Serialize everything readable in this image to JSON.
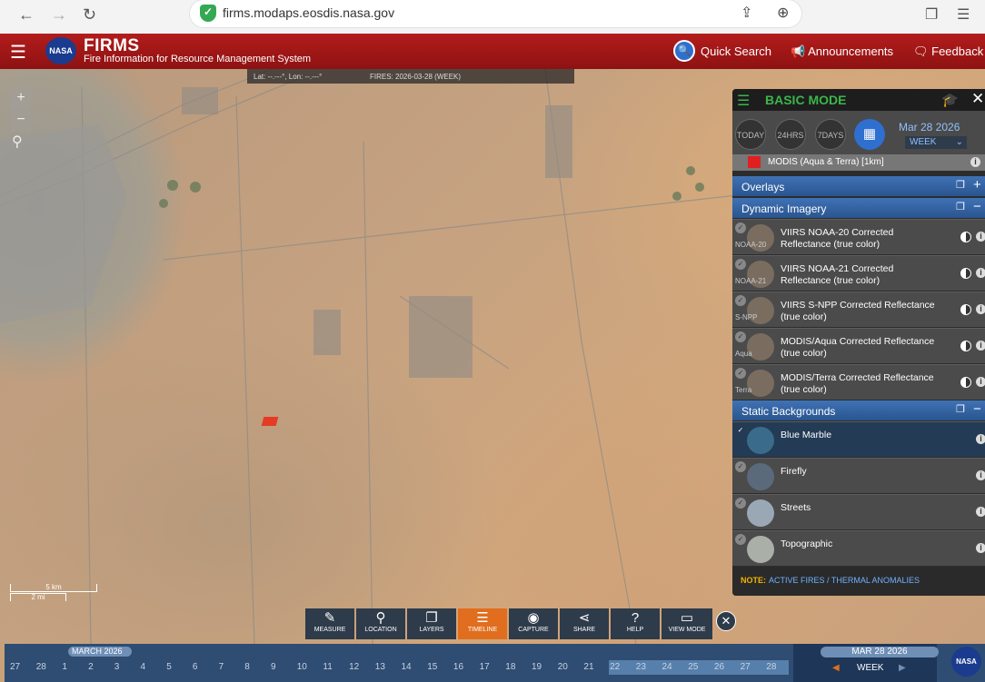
{
  "browser": {
    "url": "firms.modaps.eosdis.nasa.gov"
  },
  "header": {
    "logo_text": "NASA",
    "app_name": "FIRMS",
    "app_subtitle": "Fire Information for Resource Management System",
    "quick_search": "Quick Search",
    "announcements": "Announcements",
    "feedback": "Feedback"
  },
  "map": {
    "coords": "Lat: --.---°, Lon: --.---°",
    "fires_label": "FIRES: 2026-03-28 (WEEK)",
    "scale_km": "5 km",
    "scale_mi": "2 mi"
  },
  "toolbar": [
    {
      "icon": "✎",
      "label": "MEASURE",
      "name": "measure"
    },
    {
      "icon": "⚲",
      "label": "LOCATION",
      "name": "location"
    },
    {
      "icon": "❐",
      "label": "LAYERS",
      "name": "layers"
    },
    {
      "icon": "☰",
      "label": "TIMELINE",
      "name": "timeline",
      "active": true
    },
    {
      "icon": "◉",
      "label": "CAPTURE",
      "name": "capture"
    },
    {
      "icon": "⋖",
      "label": "SHARE",
      "name": "share"
    },
    {
      "icon": "?",
      "label": "HELP",
      "name": "help"
    },
    {
      "icon": "▭",
      "label": "VIEW MODE",
      "name": "view-mode"
    }
  ],
  "timeline": {
    "month": "MARCH 2026",
    "days": [
      "27",
      "28",
      "1",
      "2",
      "3",
      "4",
      "5",
      "6",
      "7",
      "8",
      "9",
      "10",
      "11",
      "12",
      "13",
      "14",
      "15",
      "16",
      "17",
      "18",
      "19",
      "20",
      "21",
      "22",
      "23",
      "24",
      "25",
      "26",
      "27",
      "28"
    ],
    "date": "MAR 28 2026",
    "period": "WEEK",
    "logo_text": "NASA"
  },
  "panel": {
    "mode": "BASIC MODE",
    "time_buttons": [
      "TODAY",
      "24HRS",
      "7DAYS"
    ],
    "date": "Mar 28 2026",
    "period": "WEEK",
    "fire_layer": "MODIS (Aqua & Terra) [1km]",
    "fire_color": "#e02020",
    "overlays": "Overlays",
    "dynamic": "Dynamic Imagery",
    "dynamic_layers": [
      {
        "tag": "NOAA-20",
        "name": "VIIRS NOAA-20 Corrected Reflectance (true color)"
      },
      {
        "tag": "NOAA-21",
        "name": "VIIRS NOAA-21 Corrected Reflectance (true color)"
      },
      {
        "tag": "S-NPP",
        "name": "VIIRS S-NPP Corrected Reflectance (true color)"
      },
      {
        "tag": "Aqua",
        "name": "MODIS/Aqua Corrected Reflectance (true color)"
      },
      {
        "tag": "Terra",
        "name": "MODIS/Terra Corrected Reflectance (true color)"
      }
    ],
    "static": "Static Backgrounds",
    "static_layers": [
      {
        "name": "Blue Marble",
        "selected": true
      },
      {
        "name": "Firefly"
      },
      {
        "name": "Streets"
      },
      {
        "name": "Topographic"
      }
    ],
    "note_label": "NOTE:",
    "note_text": "ACTIVE FIRES / THERMAL ANOMALIES"
  }
}
